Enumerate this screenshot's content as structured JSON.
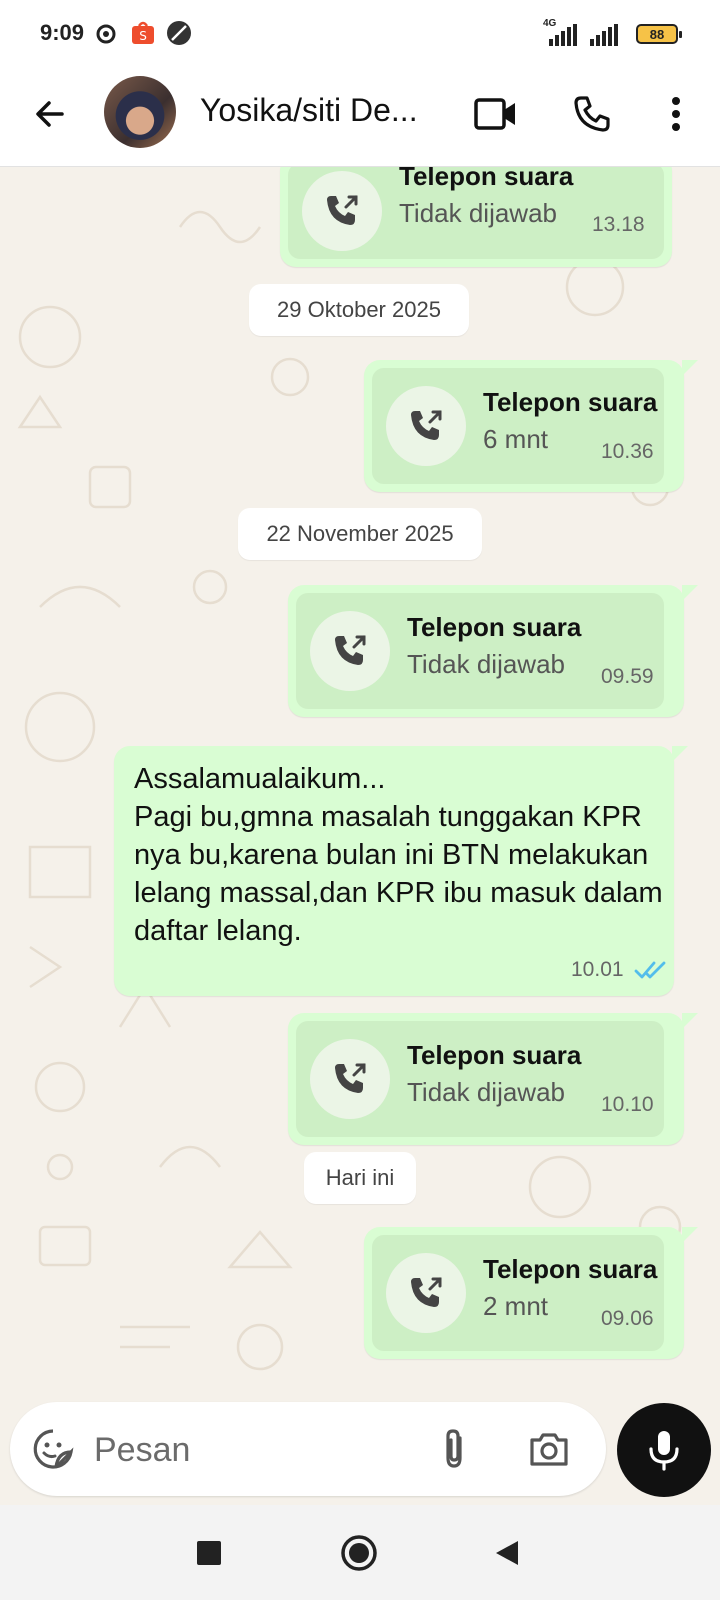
{
  "status_bar": {
    "time": "9:09",
    "network": "4G",
    "battery": "88"
  },
  "header": {
    "back_icon": "arrow-left-icon",
    "contact_name": "Yosika/siti De...",
    "video_icon": "video-call-icon",
    "call_icon": "phone-icon",
    "menu_icon": "more-vertical-icon"
  },
  "messages": [
    {
      "kind": "call",
      "title": "Telepon suara",
      "sub": "Tidak dijawab",
      "time": "13.18"
    },
    {
      "kind": "date",
      "label": "29 Oktober 2025"
    },
    {
      "kind": "call",
      "title": "Telepon suara",
      "sub": "6 mnt",
      "time": "10.36"
    },
    {
      "kind": "date",
      "label": "22 November 2025"
    },
    {
      "kind": "call",
      "title": "Telepon suara",
      "sub": "Tidak dijawab",
      "time": "09.59"
    },
    {
      "kind": "text",
      "text": "Assalamualaikum...\nPagi bu,gmna masalah tunggakan KPR nya bu,karena bulan ini BTN melakukan lelang massal,dan KPR ibu masuk dalam daftar lelang.",
      "time": "10.01",
      "status_icon": "double-check-read-icon"
    },
    {
      "kind": "call",
      "title": "Telepon suara",
      "sub": "Tidak dijawab",
      "time": "10.10"
    },
    {
      "kind": "date",
      "label": "Hari ini"
    },
    {
      "kind": "call",
      "title": "Telepon suara",
      "sub": "2 mnt",
      "time": "09.06"
    }
  ],
  "input": {
    "placeholder": "Pesan",
    "sticker_icon": "sticker-icon",
    "attach_icon": "paperclip-icon",
    "camera_icon": "camera-icon",
    "mic_icon": "microphone-icon"
  },
  "colors": {
    "outgoing_bubble": "#d9fdd3",
    "call_card": "#cdefc5",
    "chat_background": "#f5f1ea",
    "read_ticks": "#53bdeb"
  }
}
